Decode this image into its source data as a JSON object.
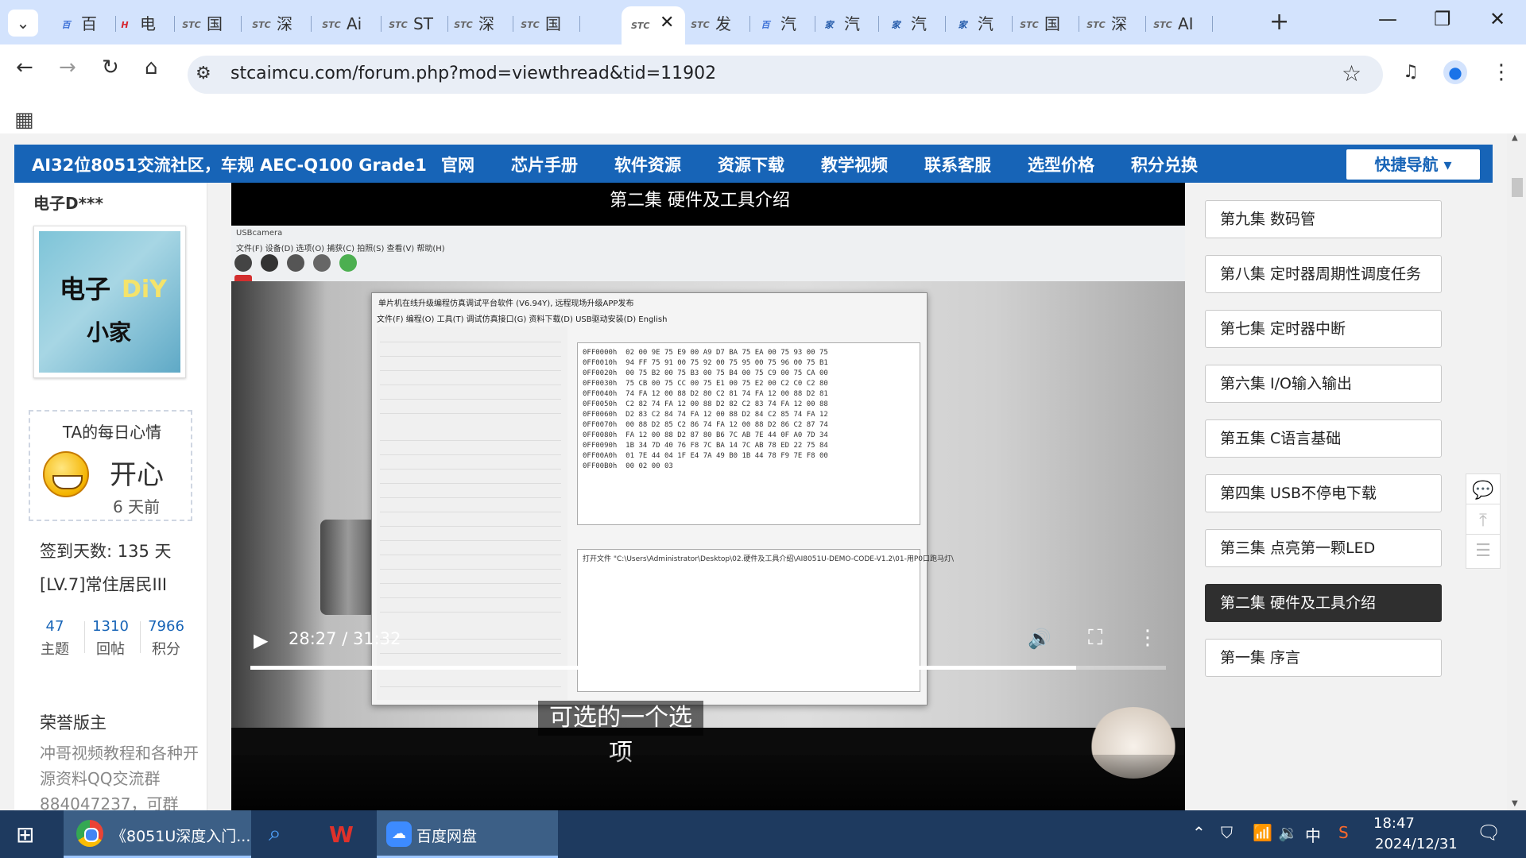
{
  "browser": {
    "tabs": [
      {
        "favicon": "百",
        "favicon_color": "#3b6fd6",
        "label": "百"
      },
      {
        "favicon": "H",
        "favicon_color": "#d6262e",
        "label": "电"
      },
      {
        "favicon": "STC",
        "favicon_color": "#666666",
        "label": "国"
      },
      {
        "favicon": "STC",
        "favicon_color": "#666666",
        "label": "深"
      },
      {
        "favicon": "STC",
        "favicon_color": "#666666",
        "label": "Ai"
      },
      {
        "favicon": "STC",
        "favicon_color": "#666666",
        "label": "ST"
      },
      {
        "favicon": "STC",
        "favicon_color": "#666666",
        "label": "深"
      },
      {
        "favicon": "STC",
        "favicon_color": "#666666",
        "label": "国"
      },
      {
        "favicon": "STC",
        "favicon_color": "#666666",
        "label": "发"
      },
      {
        "favicon": "百",
        "favicon_color": "#3b6fd6",
        "label": "汽"
      },
      {
        "favicon": "家",
        "favicon_color": "#1f57a8",
        "label": "汽"
      },
      {
        "favicon": "家",
        "favicon_color": "#1f57a8",
        "label": "汽"
      },
      {
        "favicon": "家",
        "favicon_color": "#1f57a8",
        "label": "汽"
      },
      {
        "favicon": "STC",
        "favicon_color": "#666666",
        "label": "国"
      },
      {
        "favicon": "STC",
        "favicon_color": "#666666",
        "label": "深"
      },
      {
        "favicon": "STC",
        "favicon_color": "#666666",
        "label": "AI"
      }
    ],
    "active_tab_favicon": "STC",
    "url": "stcaimcu.com/forum.php?mod=viewthread&tid=11902"
  },
  "site_nav": {
    "brand": "AI32位8051交流社区，车规 AEC-Q100 Grade1",
    "items": [
      "官网",
      "芯片手册",
      "软件资源",
      "资源下载",
      "教学视频",
      "联系客服",
      "选型价格",
      "积分兑换"
    ],
    "quick_nav": "快捷导航"
  },
  "profile": {
    "username": "电子D***",
    "avatar_text": "电子DIY小家",
    "mood_title": "TA的每日心情",
    "mood_value": "开心",
    "mood_time": "6 天前",
    "signin": "签到天数: 135 天",
    "level": "[LV.7]常住居民III",
    "stats": [
      {
        "num": "47",
        "label": "主题"
      },
      {
        "num": "1310",
        "label": "回帖"
      },
      {
        "num": "7966",
        "label": "积分"
      }
    ],
    "honor_title": "荣誉版主",
    "honor_desc": "冲哥视频教程和各种开源资料QQ交流群884047237，可群"
  },
  "video": {
    "top_title": "第二集 硬件及工具介绍",
    "subtitle": "可选的一个选项",
    "time": "28:27 / 31:32",
    "progress": 0.902,
    "usbcam_title": "USBcamera",
    "usbcam_menu": "文件(F)   设备(D)   选项(O)   捕获(C)   拍照(S)   查看(V)   帮助(H)",
    "app_title": "单片机在线升级编程仿真调试平台软件 (V6.94Y), 远程现场升级APP发布",
    "app_menu": "文件(F)   编程(O)   工具(T)   调试仿真接口(G)   资料下载(D)   USB驱动安装(D)   English",
    "hex": "0FF0000h  02 00 9E 75 E9 00 A9 D7 BA 75 EA 00 75 93 00 75\n0FF0010h  94 FF 75 91 00 75 92 00 75 95 00 75 96 00 75 B1\n0FF0020h  00 75 B2 00 75 B3 00 75 B4 00 75 C9 00 75 CA 00\n0FF0030h  75 CB 00 75 CC 00 75 E1 00 75 E2 00 C2 C0 C2 80\n0FF0040h  74 FA 12 00 88 D2 80 C2 81 74 FA 12 00 88 D2 81\n0FF0050h  C2 82 74 FA 12 00 88 D2 82 C2 83 74 FA 12 00 88\n0FF0060h  D2 83 C2 84 74 FA 12 00 88 D2 84 C2 85 74 FA 12\n0FF0070h  00 88 D2 85 C2 86 74 FA 12 00 88 D2 86 C2 87 74\n0FF0080h  FA 12 00 88 D2 87 80 B6 7C AB 7E 44 0F A0 7D 34\n0FF0090h  1B 34 7D 40 76 F8 7C BA 14 7C AB 78 ED 22 75 84\n0FF00A0h  01 7E 44 04 1F E4 7A 49 B0 1B 44 78 F9 7E F8 00\n0FF00B0h  00 02 00 03",
    "output": "打开文件  \"C:\\Users\\Administrator\\Desktop\\02.硬件及工具介绍\\AI8051U-DEMO-CODE-V1.2\\01-用P0口跑马灯\\"
  },
  "playlist": [
    {
      "label": "第九集 数码管",
      "active": false
    },
    {
      "label": "第八集 定时器周期性调度任务",
      "active": false
    },
    {
      "label": "第七集 定时器中断",
      "active": false
    },
    {
      "label": "第六集 I/O输入输出",
      "active": false
    },
    {
      "label": "第五集 C语言基础",
      "active": false
    },
    {
      "label": "第四集 USB不停电下载",
      "active": false
    },
    {
      "label": "第三集 点亮第一颗LED",
      "active": false
    },
    {
      "label": "第二集 硬件及工具介绍",
      "active": true
    },
    {
      "label": "第一集 序言",
      "active": false
    }
  ],
  "taskbar": {
    "chrome_label": "《8051U深度入门...",
    "baidu_label": "百度网盘",
    "ime": "中",
    "time": "18:47",
    "date": "2024/12/31"
  }
}
